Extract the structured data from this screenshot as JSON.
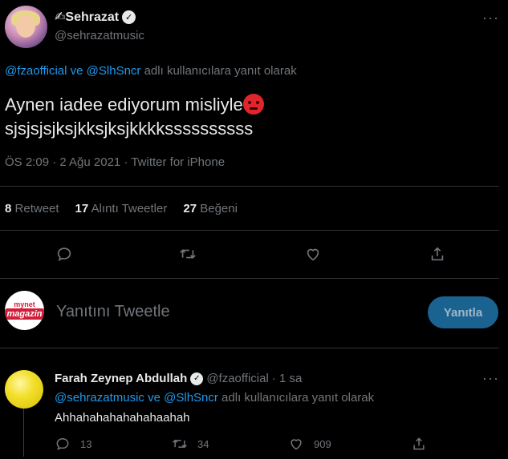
{
  "tweet": {
    "display_name": "✍Sehrazat",
    "handle": "@sehrazatmusic",
    "more_icon": "more-dots-icon",
    "reply_to": {
      "mention1": "@fzaofficial",
      "connector": "ve",
      "mention2": "@SlhSncr",
      "suffix": "adlı kullanıcılara yanıt olarak"
    },
    "text_line1": "Aynen iadee ediyorum misliyle",
    "text_line2": "sjsjsjsjksjkksjksjkkkkssssssssss",
    "emoji": "angry-face",
    "meta": "ÖS 2:09 · 2 Ağu 2021 · Twitter for iPhone",
    "stats": {
      "retweets_count": "8",
      "retweets_label": "Retweet",
      "quotes_count": "17",
      "quotes_label": "Alıntı Tweetler",
      "likes_count": "27",
      "likes_label": "Beğeni"
    },
    "actions": [
      "reply-icon",
      "retweet-icon",
      "like-icon",
      "share-icon"
    ]
  },
  "composer": {
    "avatar_line1": "mynet",
    "avatar_line2": "magazin",
    "placeholder": "Yanıtını Tweetle",
    "button_label": "Yanıtla",
    "button_color": "#1a6391"
  },
  "reply": {
    "display_name": "Farah Zeynep Abdullah",
    "handle": "@fzaofficial",
    "time": "· 1 sa",
    "reply_to": {
      "mention1": "@sehrazatmusic",
      "connector": "ve",
      "mention2": "@SlhSncr",
      "suffix": "adlı kullanıcılara yanıt olarak"
    },
    "text": "Ahhahahahahahahaahah",
    "replies": "13",
    "retweets": "34",
    "likes": "909"
  },
  "colors": {
    "background": "#000000",
    "text": "#e7e9ea",
    "muted": "#71767b",
    "link": "#1d9bf0",
    "divider": "#2f3336"
  }
}
